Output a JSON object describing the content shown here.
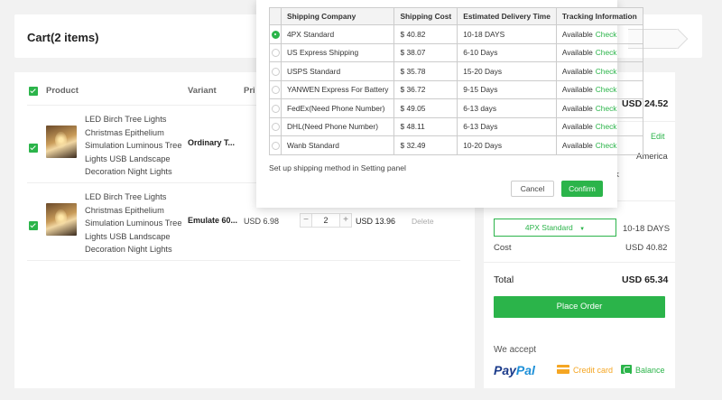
{
  "cart": {
    "title": "Cart(2 items)",
    "columns": {
      "product": "Product",
      "variant": "Variant",
      "price": "Pri"
    },
    "items": [
      {
        "name": "LED Birch Tree Lights Christmas Epithelium Simulation Luminous Tree Lights USB Landscape Decoration Night Lights",
        "variant": "Ordinary T...",
        "price": "",
        "quantity": "",
        "subtotal": "",
        "delete": ""
      },
      {
        "name": "LED Birch Tree Lights Christmas Epithelium Simulation Luminous Tree Lights USB Landscape Decoration Night Lights",
        "variant": "Emulate 60...",
        "price": "USD 6.98",
        "quantity": "2",
        "subtotal": "USD 13.96",
        "delete": "Delete"
      }
    ]
  },
  "summary": {
    "products_total": "USD 24.52",
    "edit": "Edit",
    "country": "America",
    "address_fragment": "rk",
    "shipping_method": "4PX Standard",
    "delivery": "10-18 DAYS",
    "cost_label": "Cost",
    "cost_value": "USD 40.82",
    "total_label": "Total",
    "total_value": "USD 65.34",
    "place_order": "Place Order",
    "we_accept": "We accept",
    "paypal_a": "Pay",
    "paypal_b": "Pal",
    "credit_card": "Credit card",
    "balance": "Balance"
  },
  "modal": {
    "headers": [
      "Shipping Company",
      "Shipping Cost",
      "Estimated Delivery Time",
      "Tracking Information"
    ],
    "rows": [
      {
        "company": "4PX Standard",
        "cost": "$ 40.82",
        "time": "10-18 DAYS",
        "tracking": "Available",
        "check": "Check",
        "selected": true
      },
      {
        "company": "US Express Shipping",
        "cost": "$ 38.07",
        "time": "6-10 Days",
        "tracking": "Available",
        "check": "Check",
        "selected": false
      },
      {
        "company": "USPS Standard",
        "cost": "$ 35.78",
        "time": "15-20 Days",
        "tracking": "Available",
        "check": "Check",
        "selected": false
      },
      {
        "company": "YANWEN Express For Battery",
        "cost": "$ 36.72",
        "time": "9-15 Days",
        "tracking": "Available",
        "check": "Check",
        "selected": false
      },
      {
        "company": "FedEx(Need Phone Number)",
        "cost": "$ 49.05",
        "time": "6-13 days",
        "tracking": "Available",
        "check": "Check",
        "selected": false
      },
      {
        "company": "DHL(Need Phone Number)",
        "cost": "$ 48.11",
        "time": "6-13 Days",
        "tracking": "Available",
        "check": "Check",
        "selected": false
      },
      {
        "company": "Wanb Standard",
        "cost": "$ 32.49",
        "time": "10-20 Days",
        "tracking": "Available",
        "check": "Check",
        "selected": false
      }
    ],
    "setup_note": "Set up shipping method in Setting panel",
    "cancel": "Cancel",
    "confirm": "Confirm"
  },
  "colors": {
    "accent": "#2bb44a",
    "background": "#f2f2f2"
  }
}
